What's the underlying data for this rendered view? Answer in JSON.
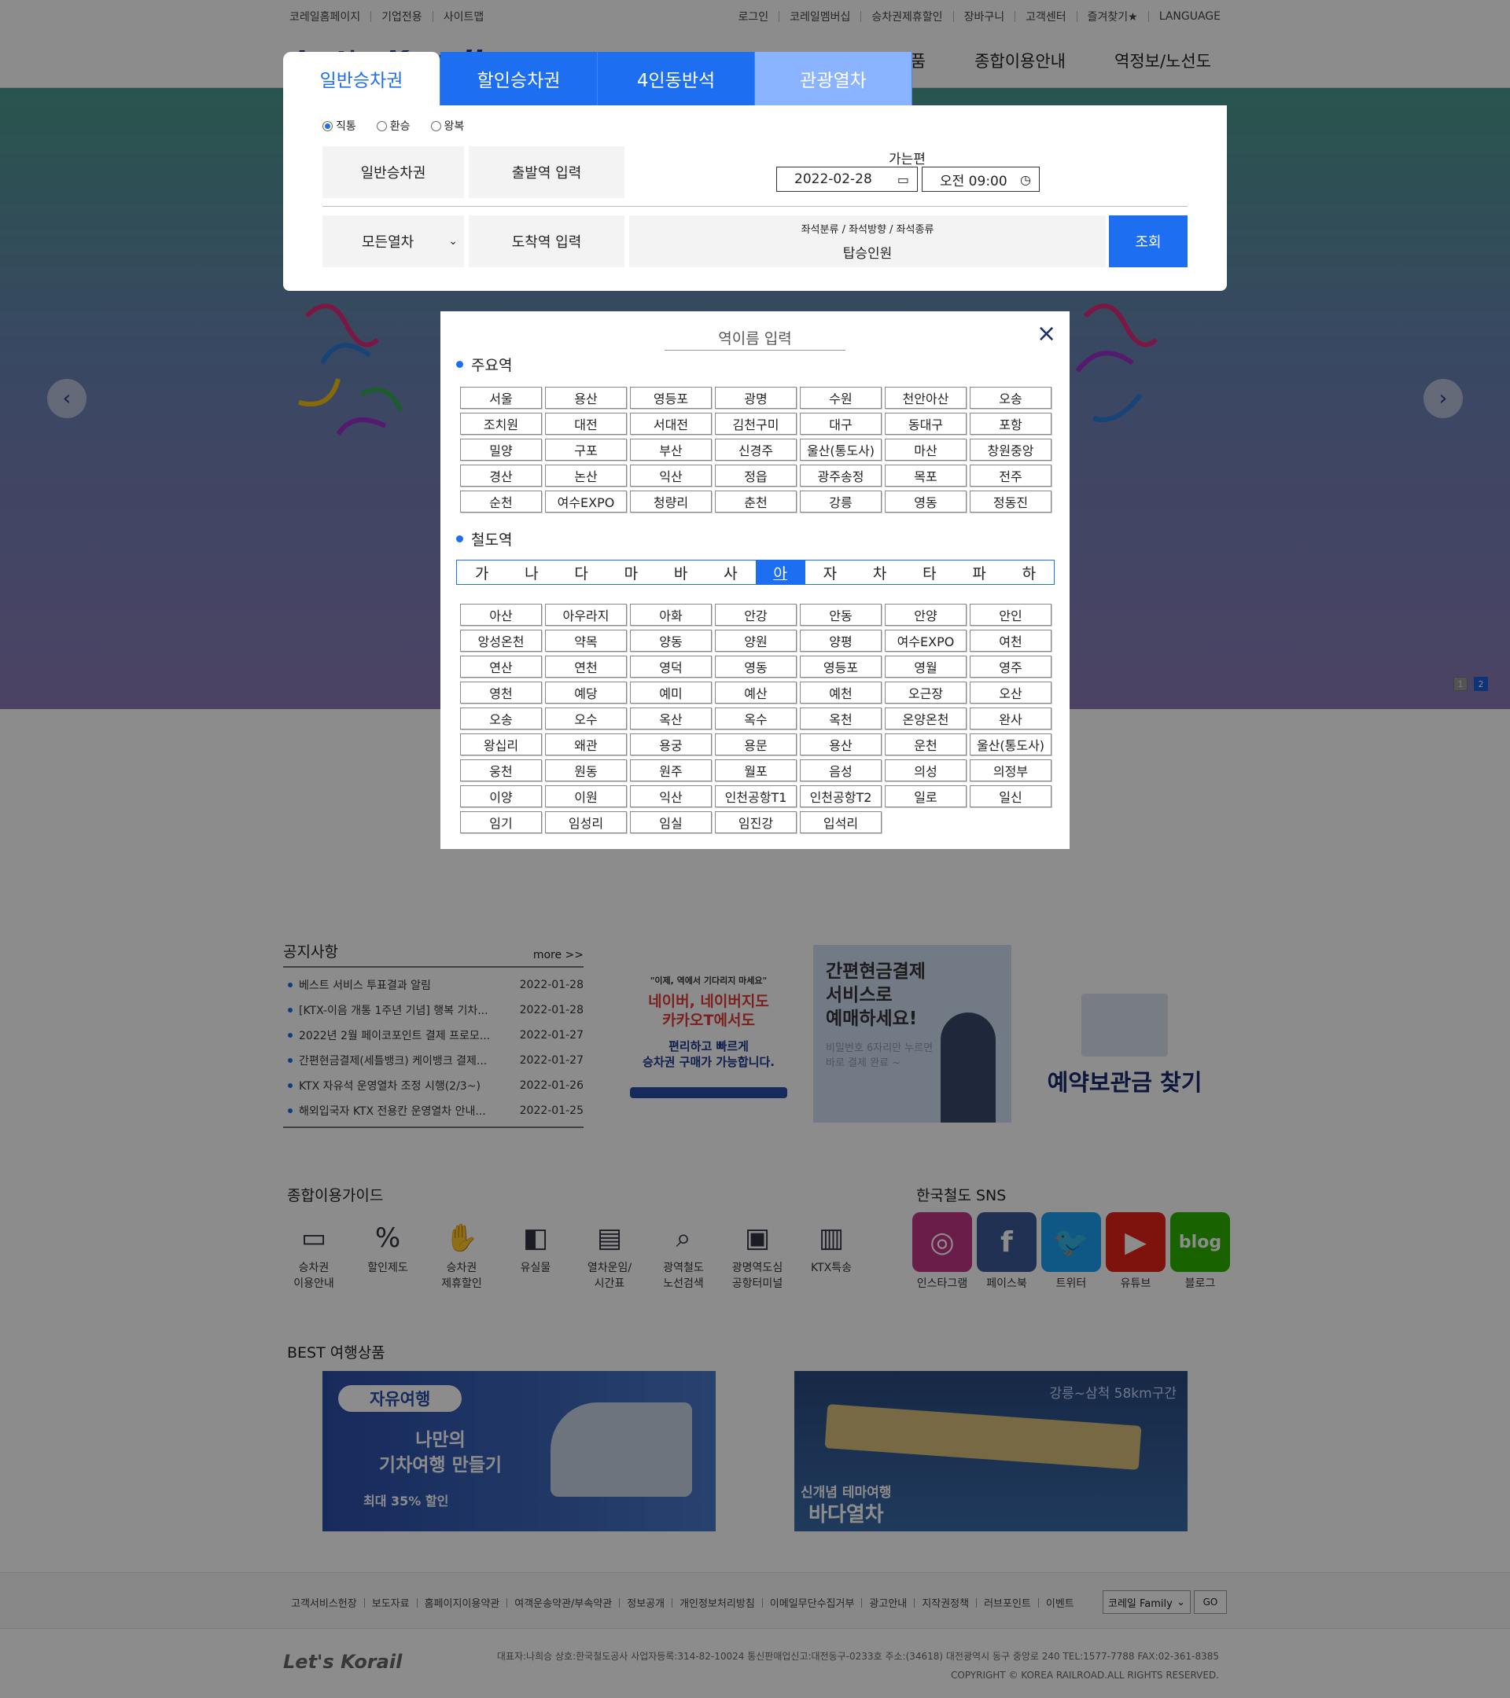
{
  "top_left_links": [
    "코레일홈페이지",
    "기업전용",
    "사이트맵"
  ],
  "top_right_links": [
    "로그인",
    "코레일멤버십",
    "승차권제휴할인",
    "장바구니",
    "고객센터",
    "즐겨찾기★",
    "LANGUAGE"
  ],
  "gnb": {
    "logo": "Let's Korail",
    "items": [
      "여행상품",
      "종합이용안내",
      "역정보/노선도"
    ]
  },
  "booking": {
    "tabs": [
      "일반승차권",
      "할인승차권",
      "4인동반석",
      "관광열차"
    ],
    "trip_types": [
      "직통",
      "환승",
      "왕복"
    ],
    "ticket_type": "일반승차권",
    "departure": "출발역 입력",
    "arrival": "도착역 입력",
    "train_select": "모든열차",
    "date_label": "가는편",
    "date": "2022-02-28",
    "time": "오전 09:00",
    "seat_options": "좌석분류 / 좌석방향 / 좌석종류",
    "passengers": "탑승인원",
    "search": "조회"
  },
  "station_popup": {
    "input_placeholder": "역이름 입력",
    "close": "×",
    "major_title": "주요역",
    "major": [
      "서울",
      "용산",
      "영등포",
      "광명",
      "수원",
      "천안아산",
      "오송",
      "조치원",
      "대전",
      "서대전",
      "김천구미",
      "대구",
      "동대구",
      "포항",
      "밀양",
      "구포",
      "부산",
      "신경주",
      "울산(통도사)",
      "마산",
      "창원중앙",
      "경산",
      "논산",
      "익산",
      "정읍",
      "광주송정",
      "목포",
      "전주",
      "순천",
      "여수EXPO",
      "청량리",
      "춘천",
      "강릉",
      "영동",
      "정동진"
    ],
    "rail_title": "철도역",
    "consonants": [
      "가",
      "나",
      "다",
      "마",
      "바",
      "사",
      "아",
      "자",
      "차",
      "타",
      "파",
      "하"
    ],
    "active_consonant": "아",
    "stations": [
      "아산",
      "아우라지",
      "아화",
      "안강",
      "안동",
      "안양",
      "안인",
      "앙성온천",
      "약목",
      "양동",
      "양원",
      "양평",
      "여수EXPO",
      "여천",
      "연산",
      "연천",
      "영덕",
      "영동",
      "영등포",
      "영월",
      "영주",
      "영천",
      "예당",
      "예미",
      "예산",
      "예천",
      "오근장",
      "오산",
      "오송",
      "오수",
      "옥산",
      "옥수",
      "옥천",
      "온양온천",
      "완사",
      "왕십리",
      "왜관",
      "용궁",
      "용문",
      "용산",
      "운천",
      "울산(통도사)",
      "웅천",
      "원동",
      "원주",
      "월포",
      "음성",
      "의성",
      "의정부",
      "이양",
      "이원",
      "익산",
      "인천공항T1",
      "인천공항T2",
      "일로",
      "일신",
      "임기",
      "임성리",
      "임실",
      "임진강",
      "입석리"
    ]
  },
  "hero": {
    "pages": [
      "1",
      "2"
    ],
    "active_page": "2"
  },
  "notice": {
    "title": "공지사항",
    "more": "more >>",
    "items": [
      {
        "title": "베스트 서비스 투표결과 알림",
        "date": "2022-01-28"
      },
      {
        "title": "[KTX-이음 개통 1주년 기념] 행복 기차...",
        "date": "2022-01-28"
      },
      {
        "title": "2022년 2월 페이코포인트 결제 프로모...",
        "date": "2022-01-27"
      },
      {
        "title": "간편현금결제(세틀뱅크) 케이뱅크 결제...",
        "date": "2022-01-27"
      },
      {
        "title": "KTX 자유석 운영열차 조정 시행(2/3~)",
        "date": "2022-01-26"
      },
      {
        "title": "해외입국자 KTX 전용칸 운영열차 안내...",
        "date": "2022-01-25"
      }
    ]
  },
  "banners": {
    "b1": {
      "small": "\"이제, 역에서 기다리지 마세요\"",
      "red": "네이버, 네이버지도\n카카오T에서도",
      "blue": "편리하고 빠르게\n승차권 구매가 가능합니다."
    },
    "b2": {
      "head": "간편현금결제\n서비스로\n예매하세요!",
      "sub": "비밀번호 6자리만 누르면\n바로 결제 완료 ~"
    },
    "b3": {
      "text": "예약보관금 찾기"
    }
  },
  "guide": {
    "title": "종합이용가이드",
    "items": [
      {
        "label": "승차권\n이용안내",
        "icon": "ticket-icon"
      },
      {
        "label": "할인제도",
        "icon": "discount-icon"
      },
      {
        "label": "승차권\n제휴할인",
        "icon": "handshake-icon"
      },
      {
        "label": "유실물",
        "icon": "lost-item-icon"
      },
      {
        "label": "열차운임/\n시간표",
        "icon": "timetable-icon"
      },
      {
        "label": "광역철도\n노선검색",
        "icon": "route-search-icon"
      },
      {
        "label": "광명역도심\n공항터미널",
        "icon": "terminal-icon"
      },
      {
        "label": "KTX특송",
        "icon": "delivery-icon"
      }
    ]
  },
  "sns": {
    "title": "한국철도 SNS",
    "items": [
      {
        "label": "인스타그램",
        "glyph": "◎",
        "color": "#c13584"
      },
      {
        "label": "페이스북",
        "glyph": "f",
        "color": "#3b5998"
      },
      {
        "label": "트위터",
        "glyph": "🐦",
        "color": "#1da1f2"
      },
      {
        "label": "유튜브",
        "glyph": "▶",
        "color": "#e62117"
      },
      {
        "label": "블로그",
        "glyph": "blog",
        "color": "#2db400"
      }
    ]
  },
  "best": {
    "title": "BEST 여행상품",
    "p1": {
      "tag": "자유여행",
      "text": "나만의\n기차여행 만들기",
      "sub": "최대 35% 할인"
    },
    "p2": {
      "top": "강릉~삼척 58km구간",
      "small": "신개념 테마여행",
      "big": "바다열차"
    }
  },
  "footer": {
    "links": [
      "고객서비스헌장",
      "보도자료",
      "홈페이지이용약관",
      "여객운송약관/부속약관",
      "정보공개",
      "개인정보처리방침",
      "이메일무단수집거부",
      "광고안내",
      "지작권정책",
      "러브포인트",
      "이벤트"
    ],
    "family": "코레일 Family",
    "go": "GO",
    "logo": "Let's Korail",
    "info": "대표자:나희승   상호:한국철도공사   사업자등록:314-82-10024   통신판매업신고:대전동구-0233호   주소:(34618) 대전광역시 동구 중앙로 240   TEL:1577-7788   FAX:02-361-8385",
    "copyright": "COPYRIGHT © KOREA RAILROAD.ALL RIGHTS RESERVED."
  }
}
